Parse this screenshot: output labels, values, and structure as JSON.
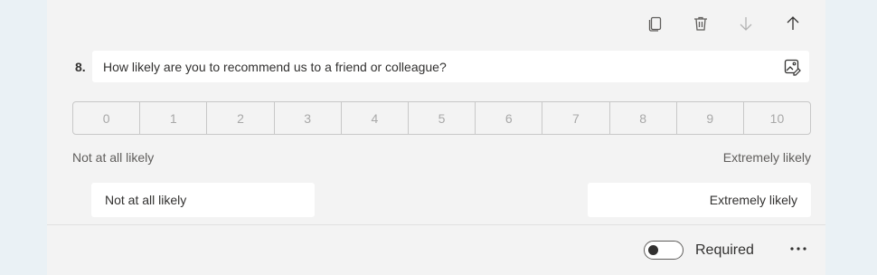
{
  "question": {
    "number": "8.",
    "title": "How likely are you to recommend us to a friend or colleague?"
  },
  "toolbar": {
    "icons": [
      "copy-icon",
      "trash-icon",
      "arrow-down-icon",
      "arrow-up-icon"
    ]
  },
  "scale": {
    "values": [
      "0",
      "1",
      "2",
      "3",
      "4",
      "5",
      "6",
      "7",
      "8",
      "9",
      "10"
    ],
    "low_label": "Not at all likely",
    "high_label": "Extremely likely"
  },
  "label_inputs": {
    "low_value": "Not at all likely",
    "high_value": "Extremely likely"
  },
  "footer": {
    "required_label": "Required",
    "required_on": false
  },
  "colors": {
    "card_bg": "#f3f3f3",
    "page_bg": "#eaf1f5",
    "text": "#323130",
    "muted": "#605e5c",
    "scale_text": "#a8a8a8"
  }
}
